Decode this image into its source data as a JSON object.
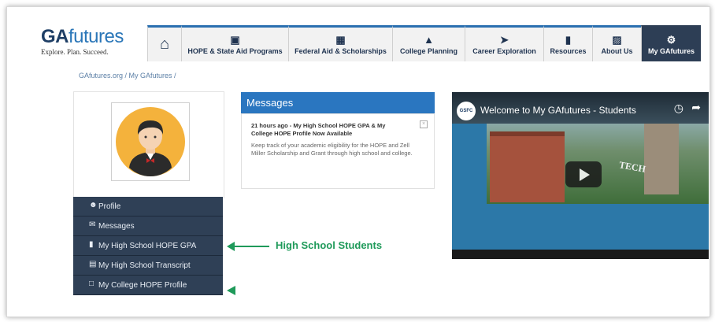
{
  "logo": {
    "brand_ga": "GA",
    "brand_futures": "futures",
    "tagline": "Explore. Plan. Succeed."
  },
  "nav": {
    "items": [
      {
        "label": "",
        "icon": "home-icon"
      },
      {
        "label": "HOPE & State Aid Programs",
        "icon": "gift-icon"
      },
      {
        "label": "Federal Aid & Scholarships",
        "icon": "money-icon"
      },
      {
        "label": "College Planning",
        "icon": "graduation-cap-icon"
      },
      {
        "label": "Career Exploration",
        "icon": "paper-plane-icon"
      },
      {
        "label": "Resources",
        "icon": "book-icon"
      },
      {
        "label": "About Us",
        "icon": "briefcase-icon"
      },
      {
        "label": "My GAfutures",
        "icon": "gear-icon"
      }
    ]
  },
  "breadcrumb": "GAfutures.org / My GAfutures /",
  "sidebar": {
    "items": [
      {
        "label": "Profile",
        "icon": "user-icon"
      },
      {
        "label": "Messages",
        "icon": "envelope-icon"
      },
      {
        "label": "My High School HOPE GPA",
        "icon": "book-icon"
      },
      {
        "label": "My High School Transcript",
        "icon": "document-icon"
      },
      {
        "label": "My College HOPE Profile",
        "icon": "file-icon"
      }
    ]
  },
  "messages": {
    "header": "Messages",
    "title": "21 hours ago - My High School HOPE GPA & My College HOPE Profile Now Available",
    "body": "Keep track of your academic eligibility for the HOPE and Zell Miller Scholarship and Grant through high school and college.",
    "close_glyph": "×"
  },
  "video": {
    "channel_logo": "GSFC",
    "title": "Welcome to My GAfutures - Students",
    "overlay_text": "TECH"
  },
  "annotation": "High School Students",
  "colors": {
    "accent": "#2a76c0",
    "nav_active": "#2d3e55",
    "sidebar": "#2f4056",
    "annotation": "#1f9a5a"
  }
}
